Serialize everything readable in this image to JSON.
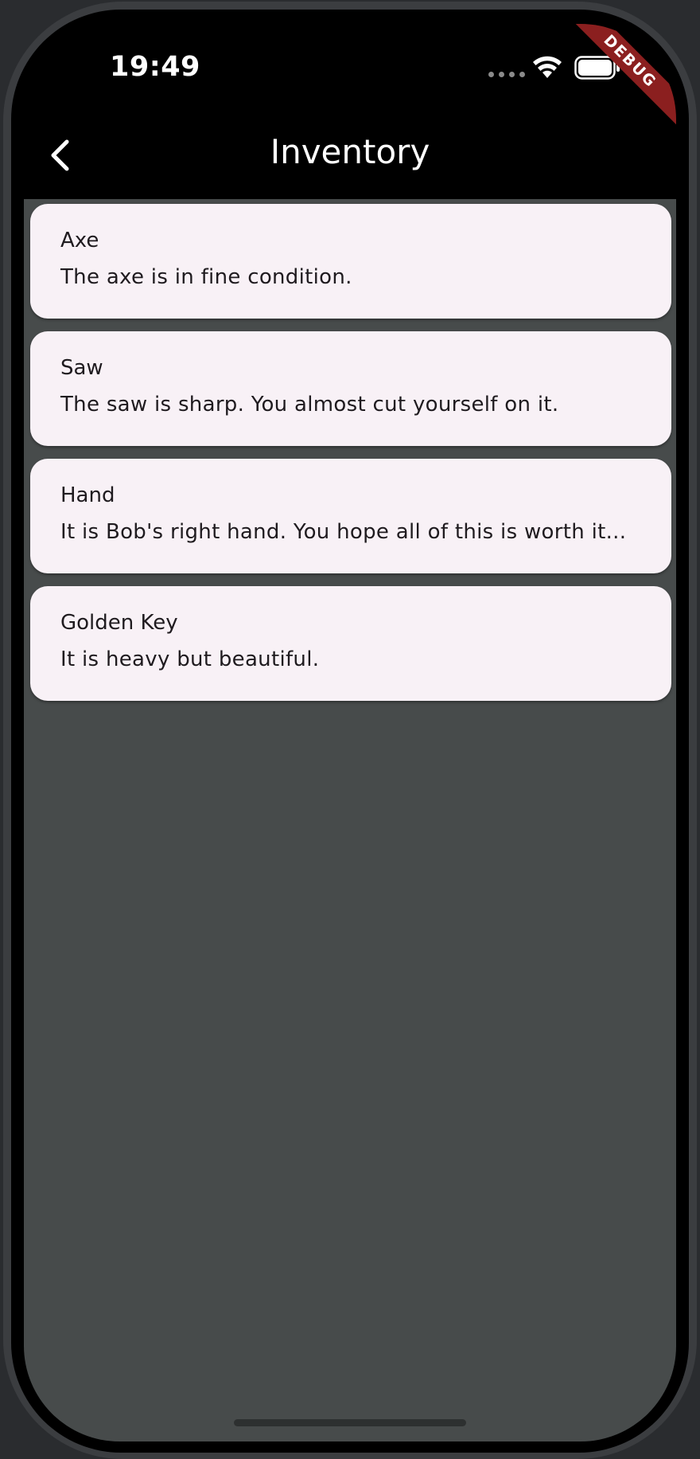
{
  "status_bar": {
    "time": "19:49",
    "icons": [
      "cellular-dots-icon",
      "wifi-icon",
      "battery-icon"
    ]
  },
  "debug_banner": {
    "label": "DEBUG",
    "color": "#8b1f1f"
  },
  "app_bar": {
    "title": "Inventory",
    "back_icon": "chevron-left-icon"
  },
  "items": [
    {
      "name": "Axe",
      "description": "The axe is in fine condition."
    },
    {
      "name": "Saw",
      "description": "The saw is sharp. You almost cut yourself on it."
    },
    {
      "name": "Hand",
      "description": "It is Bob's right hand. You hope all of this is worth it..."
    },
    {
      "name": "Golden Key",
      "description": "It is heavy but beautiful."
    }
  ],
  "colors": {
    "background": "#474b4b",
    "card": "#f8f1f6",
    "app_bar": "#000000",
    "text_on_card": "#1f1b1f"
  }
}
